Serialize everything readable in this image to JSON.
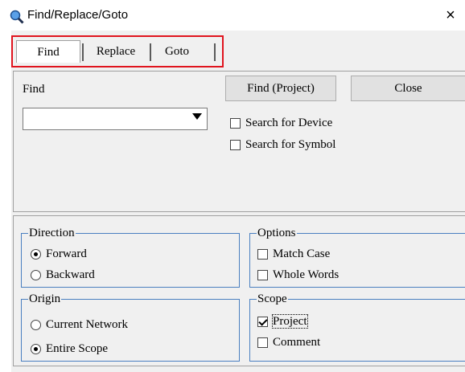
{
  "window": {
    "title": "Find/Replace/Goto",
    "close_glyph": "×",
    "icon": "magnifier-icon"
  },
  "tabs": [
    {
      "label": "Find",
      "selected": true
    },
    {
      "label": "Replace",
      "selected": false
    },
    {
      "label": "Goto",
      "selected": false
    }
  ],
  "highlight_color": "#e0141e",
  "find": {
    "label": "Find",
    "value": "",
    "search_for_device": {
      "label": "Search for Device",
      "checked": false
    },
    "search_for_symbol": {
      "label": "Search for Symbol",
      "checked": false
    }
  },
  "buttons": {
    "find_project": "Find (Project)",
    "close": "Close"
  },
  "direction": {
    "title": "Direction",
    "options": [
      {
        "label": "Forward",
        "selected": true
      },
      {
        "label": "Backward",
        "selected": false
      }
    ]
  },
  "options": {
    "title": "Options",
    "match_case": {
      "label": "Match Case",
      "checked": false
    },
    "whole_words": {
      "label": "Whole Words",
      "checked": false
    }
  },
  "origin": {
    "title": "Origin",
    "options": [
      {
        "label": "Current Network",
        "selected": false
      },
      {
        "label": "Entire Scope",
        "selected": true
      }
    ]
  },
  "scope": {
    "title": "Scope",
    "project": {
      "label": "Project",
      "checked": true
    },
    "comment": {
      "label": "Comment",
      "checked": false
    }
  }
}
